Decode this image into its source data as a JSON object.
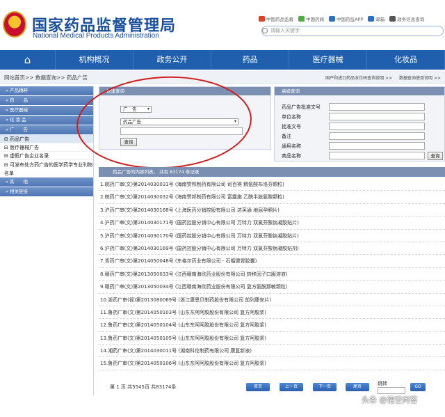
{
  "header": {
    "title": "国家药品监督管理局",
    "subtitle": "National Medical Products Administration",
    "top_links": [
      {
        "label": "中国药品监督",
        "icon": "weibo-icon",
        "color": "#d9412e"
      },
      {
        "label": "中国药闻",
        "icon": "wechat-icon",
        "color": "#4cae3c"
      },
      {
        "label": "中国药监APP",
        "icon": "app-icon",
        "color": "#2a6fc9"
      },
      {
        "label": "邮箱",
        "icon": "mail-icon",
        "color": "#2a6fc9"
      },
      {
        "label": "政务信息查询",
        "icon": "info-icon",
        "color": "#555555"
      }
    ],
    "search_placeholder": "请输入关键字"
  },
  "nav": {
    "home_icon": "⌂",
    "items": [
      "机构概况",
      "政务公开",
      "药品",
      "医疗器械",
      "化妆品"
    ]
  },
  "breadcrumb": {
    "path": "网站首页>> 数据查询>> 药品广告",
    "right_links": [
      "国产和进口药品本位码查询说明 >>",
      "数据查询使用说明 >>"
    ]
  },
  "sidebar": {
    "categories_top": [
      "» 产品精粹",
      "» 药　　品",
      "» 医疗器械",
      "» 化 妆 品",
      "» 广　　告"
    ],
    "sub_items": [
      "药品广告",
      "医疗器械广告",
      "虚假广告企业名录"
    ],
    "sub_item_long": "可发布处方药广告的医学药学专业刊物名单",
    "categories_bottom": [
      "» 其　　他",
      "» 相关链接"
    ]
  },
  "quick_search": {
    "title": "快速查询",
    "category_select": "广　告",
    "type_select": "药品广告",
    "button": "查询"
  },
  "advanced_search": {
    "title": "高级查询",
    "fields": [
      "药品广告批准文号",
      "单位名称",
      "批准文号",
      "备注",
      "通用名称",
      "商品名称"
    ],
    "button": "查询"
  },
  "list": {
    "header": "药品广告的内容列表，  共有 83174 条记录",
    "rows": [
      "1.皖药广审(文)第2014030031号 (海南赞邦制药有限公司 司百得 精氨酸布洛芬颗粒)",
      "2.皖药广审(文)第2014030032号 (海南赞邦制药有限公司 富露施 乙酰半胱氨酸颗粒)",
      "3.沪药广审(文)第2014030168号 (上海医药分销控股有限公司 达芙通 地屈孕酮片)",
      "4.沪药广审(文)第2014030171号 (国药控股分销中心有限公司 万特力 双氯芬酸钠凝胶贴片)",
      "5.沪药广审(文)第2014030170号 (国药控股分销中心有限公司 万特力 双氯芬酸钠凝胶贴片)",
      "6.沪药广审(文)第2014030169号 (国药控股分销中心有限公司 万特力 双氯芬酸钠凝胶贴剂)",
      "7.青药广审(文)第2014050048号 (东格尔药业有限公司 - 石榴健胃胶囊)",
      "8.赣药广审(文)第2013050033号 (江西赣南海欣药业股份有限公司 转移因子口服溶液)",
      "9.赣药广审(文)第2013050034号 (江西赣南海欣药业股份有限公司 复方氨酚那敏颗粒)",
      "10.浙药广审(视)第2013080069号 (浙江康恩贝制药股份有限公司 前列康安片)",
      "11.鲁药广审(文)第2014050103号 (山东东阿阿胶股份有限公司 复方阿胶浆)",
      "12.鲁药广审(文)第2014050104号 (山东东阿阿胶股份有限公司 复方阿胶浆)",
      "13.鲁药广审(文)第2014050105号 (山东东阿阿胶股份有限公司 复方阿胶浆)",
      "14.湘药广审(文)第2014030011号 (湖南科伦制药有限公司 康复新液)",
      "15.鲁药广审(文)第2014050106号 (山东东阿阿胶股份有限公司 复方阿胶浆)"
    ]
  },
  "pager": {
    "info": "第 1 页 共5545页 共83174条",
    "buttons": [
      "首页",
      "上一页",
      "下一页",
      "尾页"
    ],
    "jump_label": "跳转",
    "go": "GO"
  },
  "watermark": "头条 @悟空问答"
}
